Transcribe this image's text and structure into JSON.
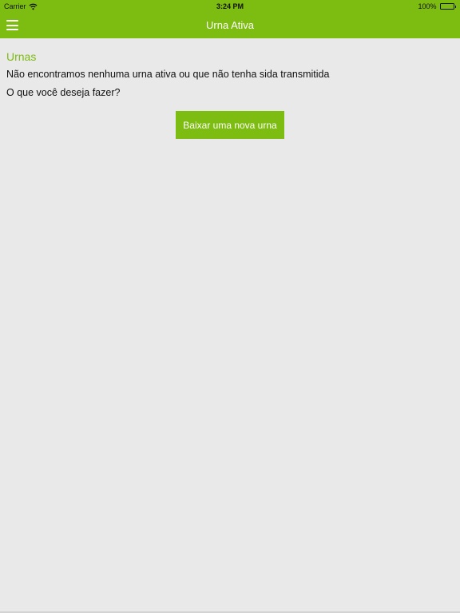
{
  "status_bar": {
    "carrier": "Carrier",
    "time": "3:24 PM",
    "battery_percent": "100%"
  },
  "nav_bar": {
    "title": "Urna Ativa",
    "menu_icon": "hamburger-menu-icon"
  },
  "main": {
    "section_title": "Urnas",
    "empty_message": "Não encontramos nenhuma urna ativa ou que não tenha sida transmitida",
    "question": "O que você deseja fazer?",
    "download_button_label": "Baixar uma nova urna"
  },
  "colors": {
    "accent": "#7dbc10",
    "background": "#e9e9e9",
    "text": "#111111"
  }
}
